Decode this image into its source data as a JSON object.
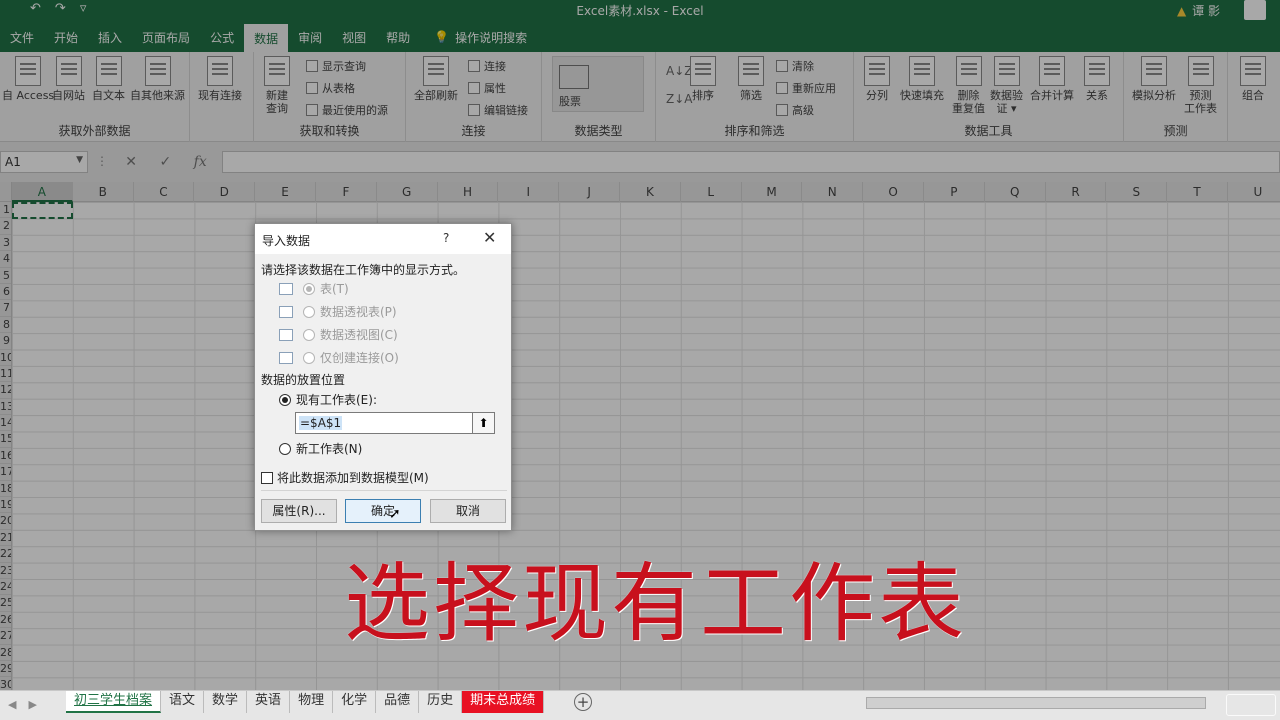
{
  "window": {
    "title": "Excel素材.xlsx  -  Excel",
    "user": "谭 影"
  },
  "ribbon_tabs": [
    {
      "label": "文件"
    },
    {
      "label": "开始"
    },
    {
      "label": "插入"
    },
    {
      "label": "页面布局"
    },
    {
      "label": "公式"
    },
    {
      "label": "数据",
      "active": true
    },
    {
      "label": "审阅"
    },
    {
      "label": "视图"
    },
    {
      "label": "帮助"
    }
  ],
  "tell_me": "操作说明搜索",
  "ribbon": {
    "get_external": {
      "name": "获取外部数据",
      "buttons": [
        "自 Access",
        "自网站",
        "自文本",
        "自其他来源",
        "现有连接"
      ]
    },
    "get_transform": {
      "name": "获取和转换",
      "new_query_1": "新建",
      "new_query_2": "查询",
      "show_queries": "显示查询",
      "from_table": "从表格",
      "recent_sources": "最近使用的源"
    },
    "connections": {
      "name": "连接",
      "refresh_all": "全部刷新",
      "connections": "连接",
      "properties": "属性",
      "edit_links": "编辑链接"
    },
    "data_types": {
      "name": "数据类型",
      "stocks": "股票"
    },
    "sort_filter": {
      "name": "排序和筛选",
      "sort": "排序",
      "filter": "筛选",
      "clear": "清除",
      "reapply": "重新应用",
      "advanced": "高级"
    },
    "data_tools": {
      "name": "数据工具",
      "buttons": [
        {
          "l1": "分列",
          "l2": ""
        },
        {
          "l1": "快速填充",
          "l2": ""
        },
        {
          "l1": "删除",
          "l2": "重复值"
        },
        {
          "l1": "数据验",
          "l2": "证 ▾"
        },
        {
          "l1": "合并计算",
          "l2": ""
        },
        {
          "l1": "关系",
          "l2": ""
        }
      ]
    },
    "forecast": {
      "name": "预测",
      "what_if": "模拟分析",
      "forecast_1": "预测",
      "forecast_2": "工作表"
    },
    "outline": {
      "group": "组合"
    }
  },
  "formula_bar": {
    "name_box": "A1",
    "fx": "fx",
    "value": ""
  },
  "columns": [
    "A",
    "B",
    "C",
    "D",
    "E",
    "F",
    "G",
    "H",
    "I",
    "J",
    "K",
    "L",
    "M",
    "N",
    "O",
    "P",
    "Q",
    "R",
    "S",
    "T",
    "U"
  ],
  "rows": [
    "1",
    "2",
    "3",
    "4",
    "5",
    "6",
    "7",
    "8",
    "9",
    "10",
    "11",
    "12",
    "13",
    "14",
    "15",
    "16",
    "17",
    "18",
    "19",
    "20",
    "21",
    "22",
    "23",
    "24",
    "25",
    "26",
    "27",
    "28",
    "29",
    "30"
  ],
  "sheet_tabs": [
    {
      "label": "初三学生档案",
      "active": true
    },
    {
      "label": "语文"
    },
    {
      "label": "数学"
    },
    {
      "label": "英语"
    },
    {
      "label": "物理"
    },
    {
      "label": "化学"
    },
    {
      "label": "品德"
    },
    {
      "label": "历史"
    },
    {
      "label": "期末总成绩",
      "highlight": "#e81123"
    }
  ],
  "dialog": {
    "title": "导入数据",
    "help": "?",
    "prompt": "请选择该数据在工作簿中的显示方式。",
    "view_options": [
      {
        "label": "表(T)",
        "checked": true
      },
      {
        "label": "数据透视表(P)"
      },
      {
        "label": "数据透视图(C)"
      },
      {
        "label": "仅创建连接(O)"
      }
    ],
    "placement_heading": "数据的放置位置",
    "existing_sheet": "现有工作表(E):",
    "reference": "=$A$1",
    "new_sheet": "新工作表(N)",
    "add_to_model": "将此数据添加到数据模型(M)",
    "properties_button": "属性(R)...",
    "ok_button": "确定",
    "cancel_button": "取消"
  },
  "caption": "选择现有工作表",
  "colors": {
    "excel_green": "#217346",
    "caption_red": "#c8101d",
    "highlight_tab": "#e81123"
  }
}
